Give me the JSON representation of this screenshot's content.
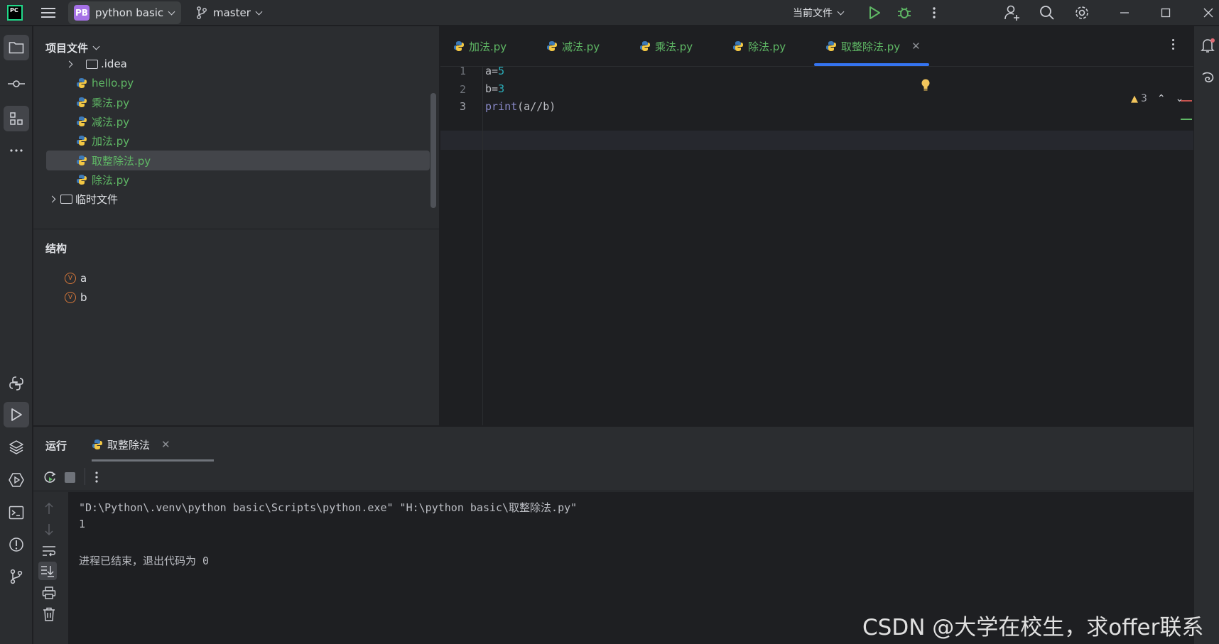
{
  "titlebar": {
    "project_badge": "PB",
    "project_name": "python basic",
    "branch": "master",
    "run_config": "当前文件"
  },
  "project_panel": {
    "title": "项目文件",
    "tree": [
      {
        "label": ".idea",
        "kind": "folder"
      },
      {
        "label": "hello.py",
        "kind": "python"
      },
      {
        "label": "乘法.py",
        "kind": "python"
      },
      {
        "label": "减法.py",
        "kind": "python"
      },
      {
        "label": "加法.py",
        "kind": "python"
      },
      {
        "label": "取整除法.py",
        "kind": "python",
        "selected": true
      },
      {
        "label": "除法.py",
        "kind": "python"
      },
      {
        "label": "临时文件",
        "kind": "folder"
      }
    ],
    "structure_title": "结构",
    "structure_items": [
      {
        "icon": "V",
        "label": "a"
      },
      {
        "icon": "V",
        "label": "b"
      }
    ]
  },
  "editor": {
    "tabs": [
      {
        "label": "加法.py"
      },
      {
        "label": "减法.py"
      },
      {
        "label": "乘法.py"
      },
      {
        "label": "除法.py"
      },
      {
        "label": "取整除法.py",
        "active": true
      }
    ],
    "line_numbers": [
      "1",
      "2",
      "3"
    ],
    "code": {
      "l1_id": "a",
      "l1_op": "=",
      "l1_num": "5",
      "l2_id": "b",
      "l2_op": "=",
      "l2_num": "3",
      "l3_fn": "print",
      "l3_rest": "(a//b)"
    },
    "warnings_count": "3",
    "colors": {
      "accent": "#3574f0",
      "file_green": "#5fb865",
      "number": "#2aacb8",
      "builtin": "#8888c6"
    }
  },
  "run_panel": {
    "title": "运行",
    "tab_label": "取整除法",
    "console": [
      "\"D:\\Python\\.venv\\python basic\\Scripts\\python.exe\" \"H:\\python basic\\取整除法.py\"",
      "1",
      "",
      "进程已结束，退出代码为 0"
    ]
  },
  "watermark": "CSDN @大学在校生，求offer联系"
}
